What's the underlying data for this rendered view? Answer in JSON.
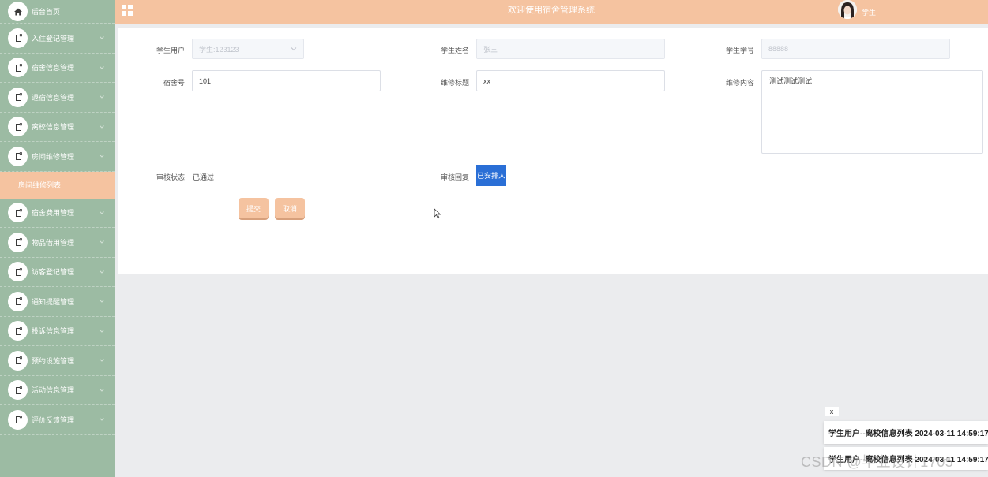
{
  "header": {
    "title": "欢迎使用宿舍管理系统",
    "user_label": "学生",
    "colors": {
      "topbar": "#f5c3a0",
      "sidebar": "#9cbba3"
    }
  },
  "sidebar": {
    "home": {
      "label": "后台首页",
      "icon": "home-icon"
    },
    "items": [
      {
        "label": "入住登记管理",
        "icon": "note-icon"
      },
      {
        "label": "宿舍信息管理",
        "icon": "note-icon"
      },
      {
        "label": "退宿信息管理",
        "icon": "note-icon"
      },
      {
        "label": "离校信息管理",
        "icon": "note-icon"
      },
      {
        "label": "房间维修管理",
        "icon": "note-icon"
      },
      {
        "label": "宿舍费用管理",
        "icon": "note-icon"
      },
      {
        "label": "物品借用管理",
        "icon": "note-icon"
      },
      {
        "label": "访客登记管理",
        "icon": "note-icon"
      },
      {
        "label": "通知提醒管理",
        "icon": "note-icon"
      },
      {
        "label": "投诉信息管理",
        "icon": "note-icon"
      },
      {
        "label": "预约设施管理",
        "icon": "note-icon"
      },
      {
        "label": "活动信息管理",
        "icon": "note-icon"
      },
      {
        "label": "评价反馈管理",
        "icon": "note-icon"
      }
    ],
    "active_sub": {
      "label": "房间维修列表"
    }
  },
  "form": {
    "student_user": {
      "label": "学生用户",
      "value": "学生:123123"
    },
    "student_name": {
      "label": "学生姓名",
      "value": "张三"
    },
    "student_no": {
      "label": "学生学号",
      "value": "88888"
    },
    "dorm_no": {
      "label": "宿舍号",
      "value": "101"
    },
    "repair_title": {
      "label": "维修标题",
      "value": "xx"
    },
    "repair_content": {
      "label": "维修内容",
      "value": "测试测试测试"
    },
    "review_status": {
      "label": "审核状态",
      "value": "已通过"
    },
    "review_reply": {
      "label": "审核回复",
      "value": "已安排人"
    },
    "submit_label": "提交",
    "cancel_label": "取消"
  },
  "notifications": {
    "close_label": "x",
    "items": [
      {
        "text": "学生用户--离校信息列表 2024-03-11 14:59:17"
      },
      {
        "text": "学生用户--离校信息列表 2024-03-11 14:59:17"
      }
    ]
  },
  "watermark": "CSDN @毕业设计1705"
}
